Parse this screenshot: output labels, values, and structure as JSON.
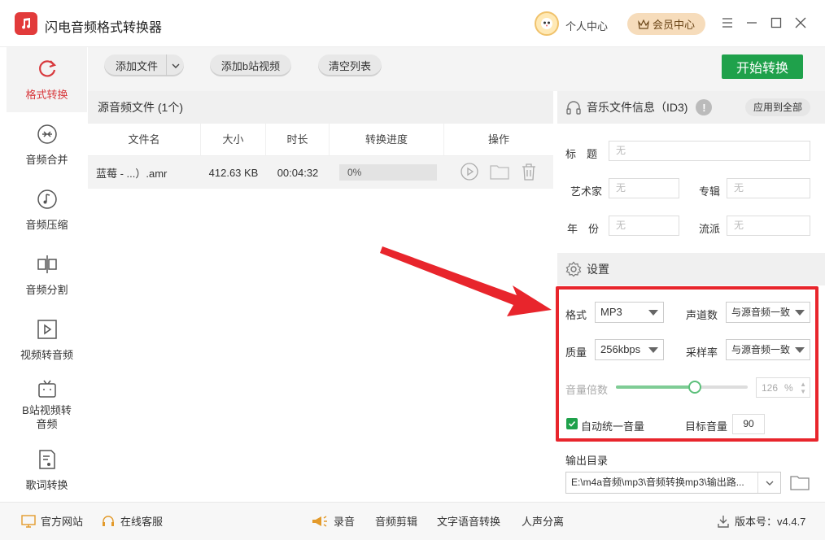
{
  "app": {
    "title": "闪电音频格式转换器",
    "user_center": "个人中心",
    "vip_center": "会员中心"
  },
  "sidebar": {
    "items": [
      {
        "label": "格式转换",
        "icon": "refresh-icon",
        "active": true
      },
      {
        "label": "音频合并",
        "icon": "merge-icon"
      },
      {
        "label": "音频压缩",
        "icon": "music-note-icon"
      },
      {
        "label": "音频分割",
        "icon": "split-icon"
      },
      {
        "label": "视频转音频",
        "icon": "video-play-icon"
      },
      {
        "label": "B站视频转音频",
        "label_line1": "B站视频转",
        "label_line2": "音频",
        "icon": "bilibili-tv-icon"
      },
      {
        "label": "歌词转换",
        "icon": "lyrics-doc-icon"
      }
    ]
  },
  "toolbar": {
    "add_file": "添加文件",
    "add_bilibili": "添加b站视频",
    "clear_list": "清空列表",
    "start": "开始转换"
  },
  "filelist": {
    "header": "源音频文件 (1个)",
    "columns": [
      "文件名",
      "大小",
      "时长",
      "转换进度",
      "操作"
    ],
    "rows": [
      {
        "name": "蓝莓 - ...）.amr",
        "size": "412.63 KB",
        "duration": "00:04:32",
        "progress_text": "0%",
        "progress": 0
      }
    ]
  },
  "id3": {
    "header": "音乐文件信息（ID3)",
    "apply_all": "应用到全部",
    "title_label": "标　题",
    "artist_label": "艺术家",
    "album_label": "专辑",
    "year_label": "年　份",
    "genre_label": "流派",
    "placeholder": "无"
  },
  "settings": {
    "header": "设置",
    "format_label": "格式",
    "format_value": "MP3",
    "channels_label": "声道数",
    "channels_value": "与源音频一致",
    "quality_label": "质量",
    "quality_value": "256kbps",
    "samplerate_label": "采样率",
    "samplerate_value": "与源音频一致",
    "volume_label": "音量倍数",
    "volume_value": "126",
    "volume_unit": "%",
    "volume_level": 0.6,
    "auto_volume_label": "自动统一音量",
    "auto_volume_checked": true,
    "target_volume_label": "目标音量",
    "target_volume_value": "90",
    "output_dir_label": "输出目录",
    "output_dir_value": "E:\\m4a音频\\mp3\\音频转换mp3\\输出路..."
  },
  "footer": {
    "website": "官方网站",
    "support": "在线客服",
    "record": "录音",
    "audio_cut": "音频剪辑",
    "tts": "文字语音转换",
    "vocal_sep": "人声分离",
    "version": "版本号：v4.4.7"
  },
  "colors": {
    "accent_red": "#d8393d",
    "start_green": "#1fa14b",
    "vip_bg": "#f6dcbb",
    "highlight_red": "#e8252c"
  }
}
